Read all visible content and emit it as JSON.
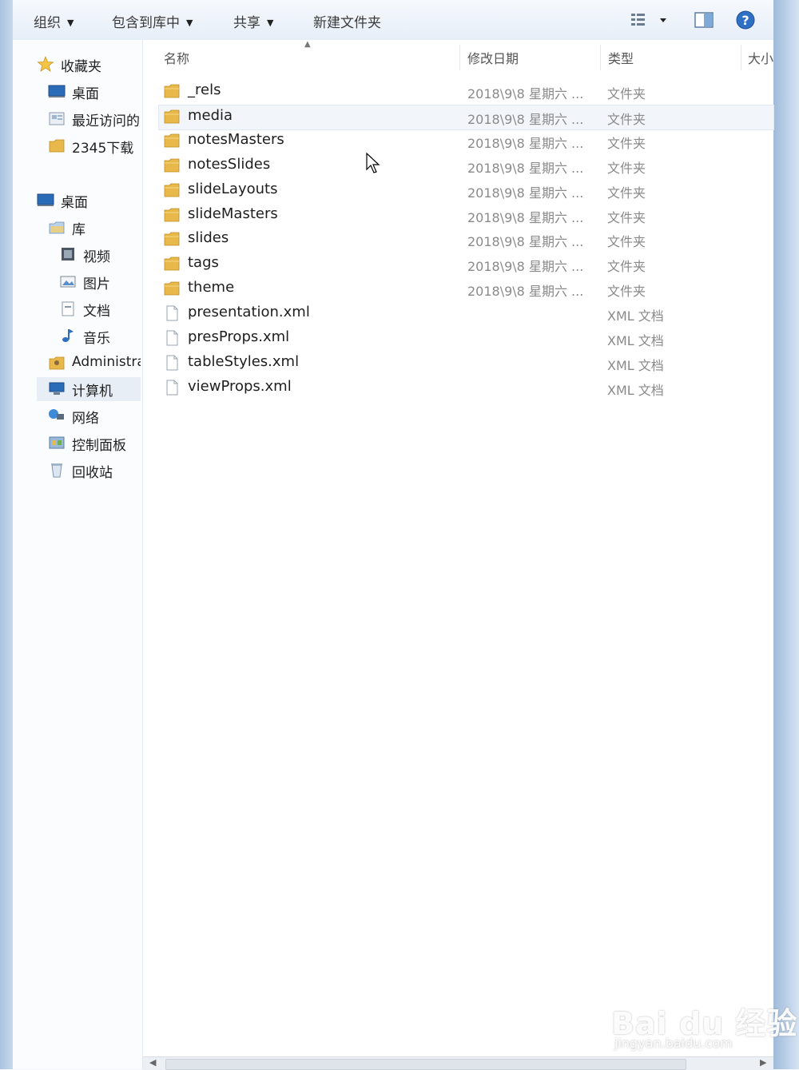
{
  "toolbar": {
    "organize": "组织",
    "include_in_library": "包含到库中",
    "share": "共享",
    "new_folder": "新建文件夹"
  },
  "nav": {
    "favorites": "收藏夹",
    "favorites_items": [
      "桌面",
      "最近访问的",
      "2345下载"
    ],
    "desktop": "桌面",
    "library": "库",
    "library_items": [
      "视频",
      "图片",
      "文档",
      "音乐"
    ],
    "admin": "Administra",
    "computer": "计算机",
    "network": "网络",
    "control_panel": "控制面板",
    "recycle_bin": "回收站"
  },
  "columns": {
    "name": "名称",
    "modified": "修改日期",
    "type": "类型",
    "size": "大小"
  },
  "files": [
    {
      "name": "_rels",
      "date": "2018\\9\\8 星期六 ...",
      "type": "文件夹",
      "kind": "folder"
    },
    {
      "name": "media",
      "date": "2018\\9\\8 星期六 ...",
      "type": "文件夹",
      "kind": "folder"
    },
    {
      "name": "notesMasters",
      "date": "2018\\9\\8 星期六 ...",
      "type": "文件夹",
      "kind": "folder"
    },
    {
      "name": "notesSlides",
      "date": "2018\\9\\8 星期六 ...",
      "type": "文件夹",
      "kind": "folder"
    },
    {
      "name": "slideLayouts",
      "date": "2018\\9\\8 星期六 ...",
      "type": "文件夹",
      "kind": "folder"
    },
    {
      "name": "slideMasters",
      "date": "2018\\9\\8 星期六 ...",
      "type": "文件夹",
      "kind": "folder"
    },
    {
      "name": "slides",
      "date": "2018\\9\\8 星期六 ...",
      "type": "文件夹",
      "kind": "folder"
    },
    {
      "name": "tags",
      "date": "2018\\9\\8 星期六 ...",
      "type": "文件夹",
      "kind": "folder"
    },
    {
      "name": "theme",
      "date": "2018\\9\\8 星期六 ...",
      "type": "文件夹",
      "kind": "folder"
    },
    {
      "name": "presentation.xml",
      "date": "",
      "type": "XML 文档",
      "kind": "file"
    },
    {
      "name": "presProps.xml",
      "date": "",
      "type": "XML 文档",
      "kind": "file"
    },
    {
      "name": "tableStyles.xml",
      "date": "",
      "type": "XML 文档",
      "kind": "file"
    },
    {
      "name": "viewProps.xml",
      "date": "",
      "type": "XML 文档",
      "kind": "file"
    }
  ],
  "watermark": {
    "main": "Bai du 经验",
    "sub": "jingyan.baidu.com"
  },
  "colors": {
    "folder": "#e8b84a",
    "accent": "#1f5fb0",
    "help": "#2f6fc4"
  }
}
